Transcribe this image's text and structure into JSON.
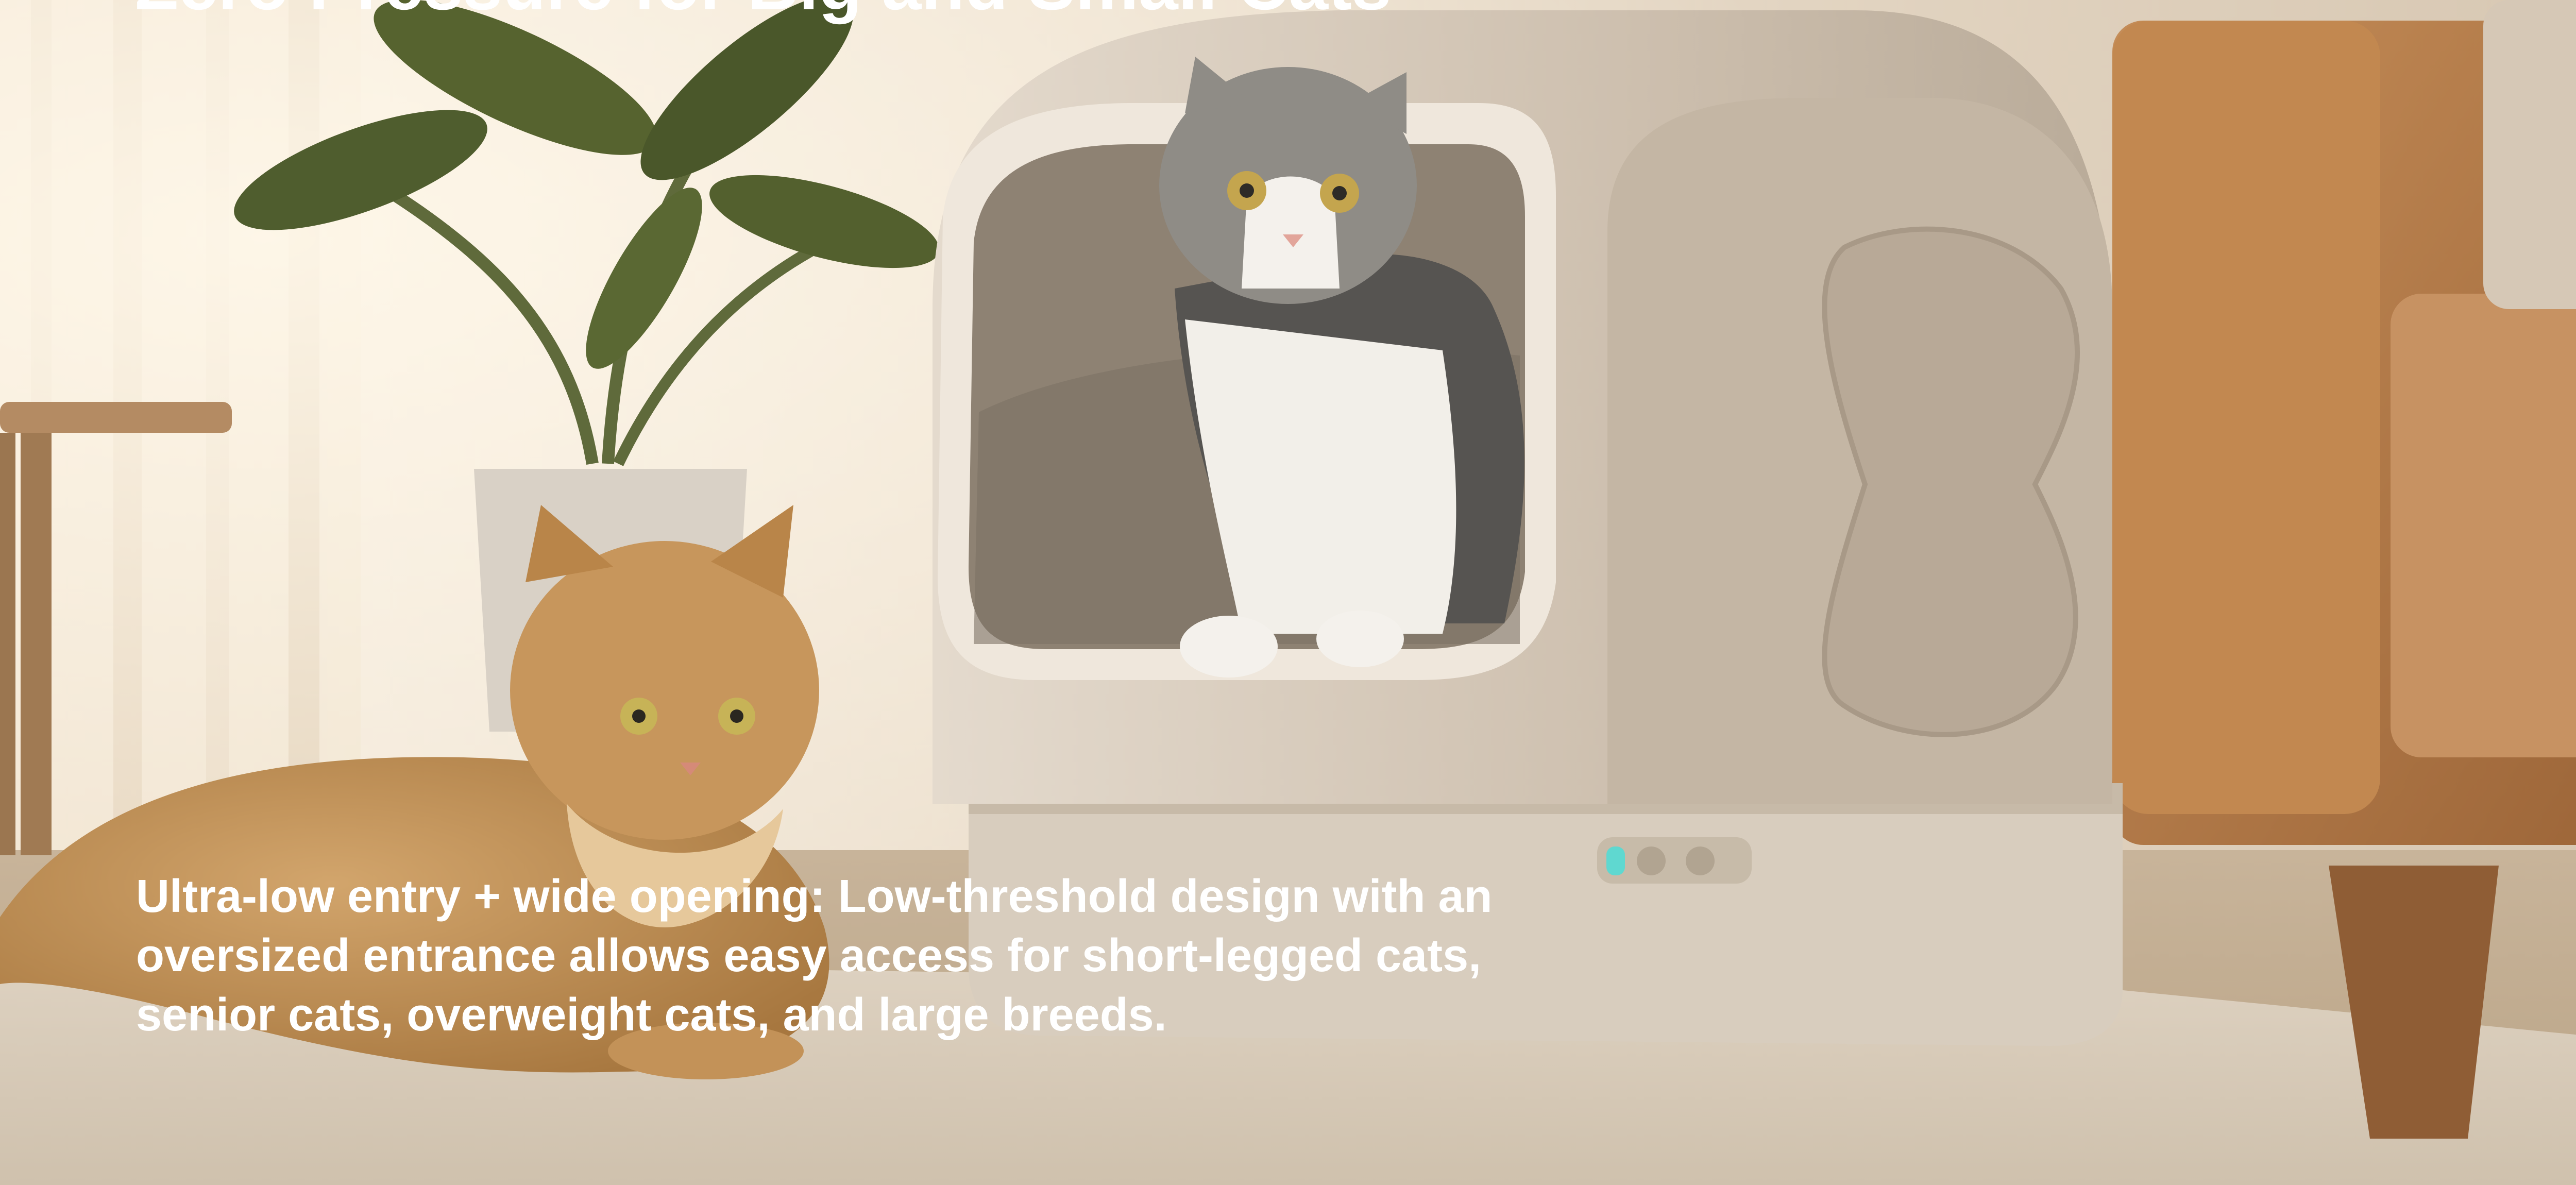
{
  "headline": "Zero Pressure for Big and Small Cats",
  "caption_lines": [
    "Ultra-low entry + wide opening: Low-threshold design with an",
    "oversized entrance allows easy access for short-legged cats,",
    "senior cats, overweight cats, and large breeds."
  ],
  "colors": {
    "wall": "#e6d8c4",
    "floor": "#c9b8a0",
    "litter_box": "#cfc2b1",
    "sofa": "#b9804d",
    "indicator_light": "#5fd8d0",
    "text": "#ffffff"
  }
}
